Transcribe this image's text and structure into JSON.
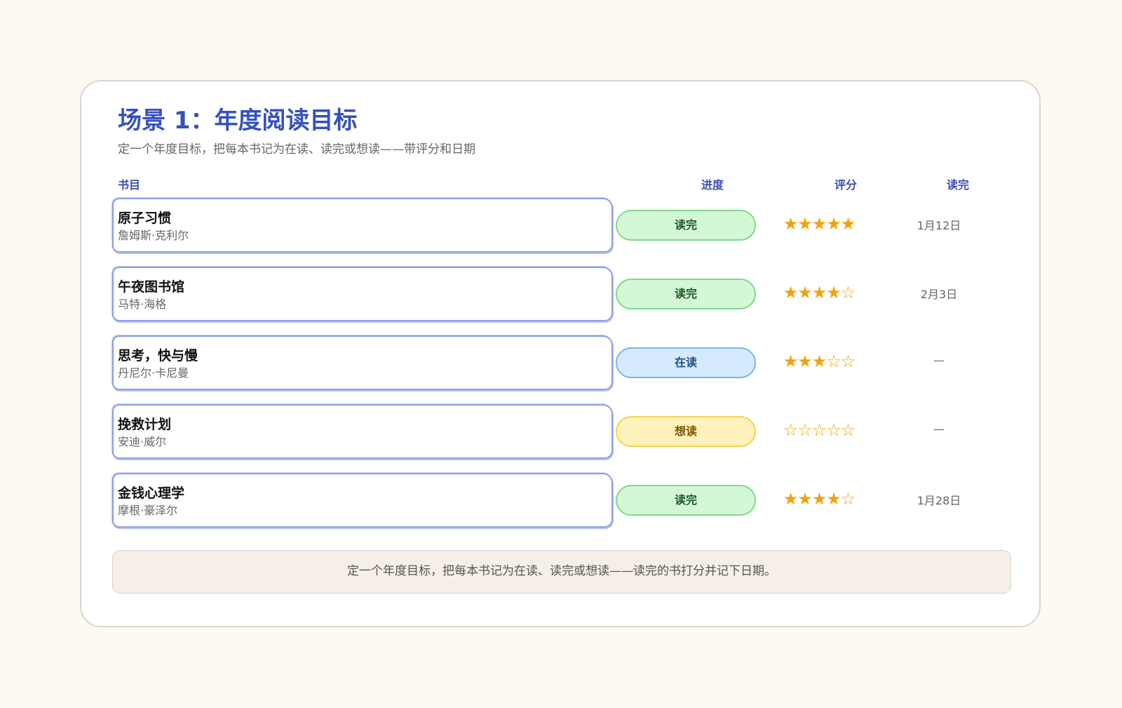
{
  "header": {
    "title": "场景 1：年度阅读目标",
    "subtitle": "定一个年度目标，把每本书记为在读、读完或想读——带评分和日期"
  },
  "columns": {
    "book": "书目",
    "progress": "进度",
    "rating": "评分",
    "finished": "读完"
  },
  "books": [
    {
      "title": "原子习惯",
      "author": "詹姆斯·克利尔",
      "status": "读完",
      "status_kind": "done",
      "rating": 5,
      "stars": "★★★★★",
      "date": "1月12日"
    },
    {
      "title": "午夜图书馆",
      "author": "马特·海格",
      "status": "读完",
      "status_kind": "done",
      "rating": 4,
      "stars": "★★★★☆",
      "date": "2月3日"
    },
    {
      "title": "思考，快与慢",
      "author": "丹尼尔·卡尼曼",
      "status": "在读",
      "status_kind": "reading",
      "rating": 3,
      "stars": "★★★☆☆",
      "date": "—"
    },
    {
      "title": "挽救计划",
      "author": "安迪·威尔",
      "status": "想读",
      "status_kind": "want",
      "rating": 0,
      "stars": "☆☆☆☆☆",
      "date": "—"
    },
    {
      "title": "金钱心理学",
      "author": "摩根·豪泽尔",
      "status": "读完",
      "status_kind": "done",
      "rating": 4,
      "stars": "★★★★☆",
      "date": "1月28日"
    }
  ],
  "footer": {
    "note": "定一个年度目标，把每本书记为在读、读完或想读——读完的书打分并记下日期。"
  },
  "colors": {
    "accent": "#3550c0",
    "done": "#d4f8d6",
    "reading": "#d5ebfd",
    "want": "#fff1ba",
    "star": "#f2a20b"
  }
}
